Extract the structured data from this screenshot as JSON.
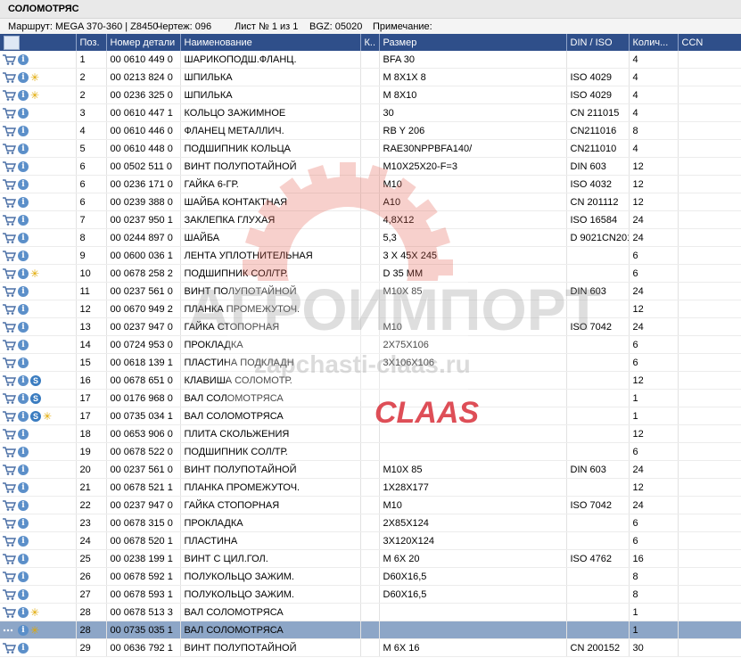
{
  "window": {
    "title": "СОЛОМОТРЯС"
  },
  "info": {
    "route": "Маршрут: MEGA 370-360 | Z8450",
    "drawing": "Чертеж: 096",
    "sheet": "Лист № 1 из 1",
    "bgz": "BGZ: 05020",
    "note": "Примечание:"
  },
  "columns": {
    "pos": "Поз.",
    "part_no": "Номер детали",
    "name": "Наименование",
    "k": "К..",
    "size": "Размер",
    "din": "DIN / ISO",
    "qty": "Колич...",
    "ccn": "CCN"
  },
  "watermark": {
    "brand": "АГРОИМПОРТ",
    "site": "zapchasti-claas.ru",
    "logo": "CLAAS",
    "colors": {
      "gear": "#e35b4a",
      "text": "#8c8c8c",
      "claas": "#d9303a"
    }
  },
  "colors": {
    "header_bg": "#2f4f8a",
    "selected_row": "#8da6c7",
    "info_icon": "#5b8fc9",
    "star": "#e0a800"
  },
  "rows": [
    {
      "pos": "1",
      "part": "00 0610 449 0",
      "name": "ШАРИКОПОДШ.ФЛАНЦ.",
      "k": "",
      "size": "BFA 30",
      "din": "",
      "qty": "4",
      "icons": [
        "cart",
        "info"
      ]
    },
    {
      "pos": "2",
      "part": "00 0213 824 0",
      "name": "ШПИЛЬКА",
      "k": "",
      "size": "M 8X1X 8",
      "din": "ISO 4029",
      "qty": "4",
      "icons": [
        "cart",
        "info",
        "star"
      ]
    },
    {
      "pos": "2",
      "part": "00 0236 325 0",
      "name": "ШПИЛЬКА",
      "k": "",
      "size": "M 8X10",
      "din": "ISO 4029",
      "qty": "4",
      "icons": [
        "cart",
        "info",
        "star"
      ]
    },
    {
      "pos": "3",
      "part": "00 0610 447 1",
      "name": "КОЛЬЦО ЗАЖИМНОЕ",
      "k": "",
      "size": "30",
      "din": "CN 211015",
      "qty": "4",
      "icons": [
        "cart",
        "info"
      ]
    },
    {
      "pos": "4",
      "part": "00 0610 446 0",
      "name": "ФЛАНЕЦ МЕТАЛЛИЧ.",
      "k": "",
      "size": "RB Y 206",
      "din": "CN211016",
      "qty": "8",
      "icons": [
        "cart",
        "info"
      ]
    },
    {
      "pos": "5",
      "part": "00 0610 448 0",
      "name": "ПОДШИПНИК КОЛЬЦА",
      "k": "",
      "size": "RAE30NPPBFA140/",
      "din": "CN211010",
      "qty": "4",
      "icons": [
        "cart",
        "info"
      ]
    },
    {
      "pos": "6",
      "part": "00 0502 511 0",
      "name": "ВИНТ ПОЛУПОТАЙНОЙ",
      "k": "",
      "size": "M10X25X20-F=3",
      "din": "DIN 603",
      "qty": "12",
      "icons": [
        "cart",
        "info"
      ]
    },
    {
      "pos": "6",
      "part": "00 0236 171 0",
      "name": "ГАЙКА 6-ГР.",
      "k": "",
      "size": "M10",
      "din": "ISO 4032",
      "qty": "12",
      "icons": [
        "cart",
        "info"
      ]
    },
    {
      "pos": "6",
      "part": "00 0239 388 0",
      "name": "ШАЙБА КОНТАКТНАЯ",
      "k": "",
      "size": "A10",
      "din": "CN 201112",
      "qty": "12",
      "icons": [
        "cart",
        "info"
      ]
    },
    {
      "pos": "7",
      "part": "00 0237 950 1",
      "name": "ЗАКЛЕПКА ГЛУХАЯ",
      "k": "",
      "size": "4,8X12",
      "din": "ISO 16584",
      "qty": "24",
      "icons": [
        "cart",
        "info"
      ]
    },
    {
      "pos": "8",
      "part": "00 0244 897 0",
      "name": "ШАЙБА",
      "k": "",
      "size": "5,3",
      "din": "D 9021CN201",
      "qty": "24",
      "icons": [
        "cart",
        "info"
      ]
    },
    {
      "pos": "9",
      "part": "00 0600 036 1",
      "name": "ЛЕНТА УПЛОТНИТЕЛЬНАЯ",
      "k": "",
      "size": "3 X 45X 245",
      "din": "",
      "qty": "6",
      "icons": [
        "cart",
        "info"
      ]
    },
    {
      "pos": "10",
      "part": "00 0678 258 2",
      "name": "ПОДШИПНИК СОЛ/ТР.",
      "k": "",
      "size": "D 35 MM",
      "din": "",
      "qty": "6",
      "icons": [
        "cart",
        "info",
        "star"
      ]
    },
    {
      "pos": "11",
      "part": "00 0237 561 0",
      "name": "ВИНТ ПОЛУПОТАЙНОЙ",
      "k": "",
      "size": "M10X 85",
      "din": "DIN 603",
      "qty": "24",
      "icons": [
        "cart",
        "info"
      ]
    },
    {
      "pos": "12",
      "part": "00 0670 949 2",
      "name": "ПЛАНКА ПРОМЕЖУТОЧ.",
      "k": "",
      "size": "",
      "din": "",
      "qty": "12",
      "icons": [
        "cart",
        "info"
      ]
    },
    {
      "pos": "13",
      "part": "00 0237 947 0",
      "name": "ГАЙКА СТОПОРНАЯ",
      "k": "",
      "size": "M10",
      "din": "ISO 7042",
      "qty": "24",
      "icons": [
        "cart",
        "info"
      ]
    },
    {
      "pos": "14",
      "part": "00 0724 953 0",
      "name": "ПРОКЛАДКА",
      "k": "",
      "size": "2X75X106",
      "din": "",
      "qty": "6",
      "icons": [
        "cart",
        "info"
      ]
    },
    {
      "pos": "15",
      "part": "00 0618 139 1",
      "name": "ПЛАСТИНА ПОДКЛАДН",
      "k": "",
      "size": "3X106X106",
      "din": "",
      "qty": "6",
      "icons": [
        "cart",
        "info"
      ]
    },
    {
      "pos": "16",
      "part": "00 0678 651 0",
      "name": "КЛАВИША СОЛОМОТР.",
      "k": "",
      "size": "",
      "din": "",
      "qty": "12",
      "icons": [
        "cart",
        "info",
        "s"
      ]
    },
    {
      "pos": "17",
      "part": "00 0176 968 0",
      "name": "ВАЛ  СОЛОМОТРЯСА",
      "k": "",
      "size": "",
      "din": "",
      "qty": "1",
      "icons": [
        "cart",
        "info",
        "s"
      ]
    },
    {
      "pos": "17",
      "part": "00 0735 034 1",
      "name": "ВАЛ  СОЛОМОТРЯСА",
      "k": "",
      "size": "",
      "din": "",
      "qty": "1",
      "icons": [
        "cart",
        "info",
        "s",
        "star"
      ]
    },
    {
      "pos": "18",
      "part": "00 0653 906 0",
      "name": "ПЛИТА СКОЛЬЖЕНИЯ",
      "k": "",
      "size": "",
      "din": "",
      "qty": "12",
      "icons": [
        "cart",
        "info"
      ]
    },
    {
      "pos": "19",
      "part": "00 0678 522 0",
      "name": "ПОДШИПНИК СОЛ/ТР.",
      "k": "",
      "size": "",
      "din": "",
      "qty": "6",
      "icons": [
        "cart",
        "info"
      ]
    },
    {
      "pos": "20",
      "part": "00 0237 561 0",
      "name": "ВИНТ ПОЛУПОТАЙНОЙ",
      "k": "",
      "size": "M10X 85",
      "din": "DIN 603",
      "qty": "24",
      "icons": [
        "cart",
        "info"
      ]
    },
    {
      "pos": "21",
      "part": "00 0678 521 1",
      "name": "ПЛАНКА ПРОМЕЖУТОЧ.",
      "k": "",
      "size": "1X28X177",
      "din": "",
      "qty": "12",
      "icons": [
        "cart",
        "info"
      ]
    },
    {
      "pos": "22",
      "part": "00 0237 947 0",
      "name": "ГАЙКА СТОПОРНАЯ",
      "k": "",
      "size": "M10",
      "din": "ISO 7042",
      "qty": "24",
      "icons": [
        "cart",
        "info"
      ]
    },
    {
      "pos": "23",
      "part": "00 0678 315 0",
      "name": "ПРОКЛАДКА",
      "k": "",
      "size": "2X85X124",
      "din": "",
      "qty": "6",
      "icons": [
        "cart",
        "info"
      ]
    },
    {
      "pos": "24",
      "part": "00 0678 520 1",
      "name": "ПЛАСТИНА",
      "k": "",
      "size": "3X120X124",
      "din": "",
      "qty": "6",
      "icons": [
        "cart",
        "info"
      ]
    },
    {
      "pos": "25",
      "part": "00 0238 199 1",
      "name": "ВИНТ С ЦИЛ.ГОЛ.",
      "k": "",
      "size": "M 6X 20",
      "din": "ISO 4762",
      "qty": "16",
      "icons": [
        "cart",
        "info"
      ]
    },
    {
      "pos": "26",
      "part": "00 0678 592 1",
      "name": "ПОЛУКОЛЬЦО ЗАЖИМ.",
      "k": "",
      "size": "D60X16,5",
      "din": "",
      "qty": "8",
      "icons": [
        "cart",
        "info"
      ]
    },
    {
      "pos": "27",
      "part": "00 0678 593 1",
      "name": "ПОЛУКОЛЬЦО ЗАЖИМ.",
      "k": "",
      "size": "D60X16,5",
      "din": "",
      "qty": "8",
      "icons": [
        "cart",
        "info"
      ]
    },
    {
      "pos": "28",
      "part": "00 0678 513 3",
      "name": "ВАЛ  СОЛОМОТРЯСА",
      "k": "",
      "size": "",
      "din": "",
      "qty": "1",
      "icons": [
        "cart",
        "info",
        "star"
      ]
    },
    {
      "pos": "28",
      "part": "00 0735 035 1",
      "name": "ВАЛ СОЛОМОТРЯСА",
      "k": "",
      "size": "",
      "din": "",
      "qty": "1",
      "icons": [
        "dots",
        "info",
        "star"
      ],
      "selected": true
    },
    {
      "pos": "29",
      "part": "00 0636 792 1",
      "name": "ВИНТ ПОЛУПОТАЙНОЙ",
      "k": "",
      "size": "M 6X 16",
      "din": "CN 200152",
      "qty": "30",
      "icons": [
        "cart",
        "info"
      ]
    }
  ]
}
